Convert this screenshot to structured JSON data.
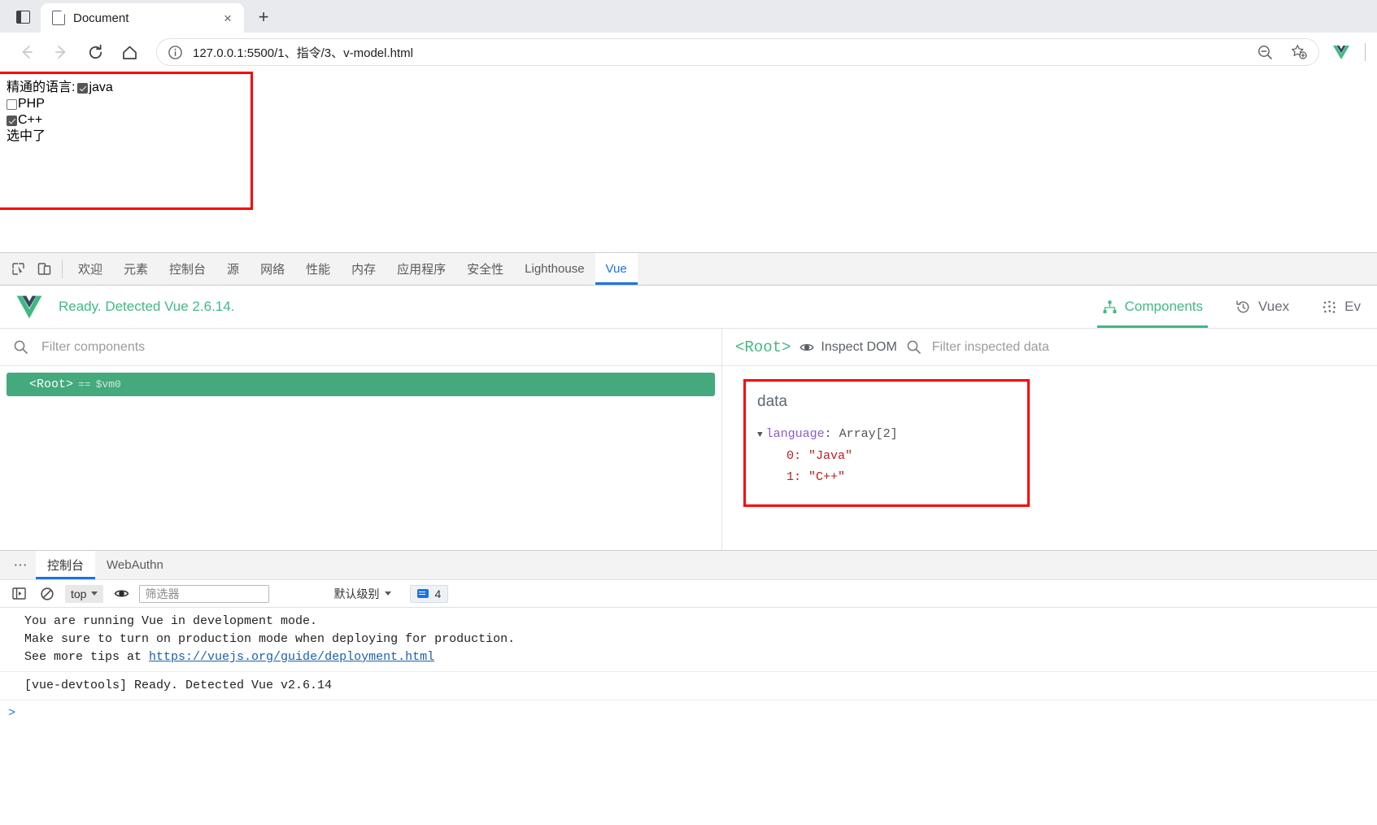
{
  "browser": {
    "window_icon": "window-panel-icon",
    "tab": {
      "title": "Document",
      "favicon": "document-icon",
      "close_label": "×"
    },
    "new_tab_label": "+",
    "nav": {
      "back": "←",
      "forward": "→",
      "reload": "↻",
      "home": "⌂"
    },
    "omnibox": {
      "info_icon": "info-circle-icon",
      "url": "127.0.0.1:5500/1、指令/3、v-model.html",
      "zoom_out_icon": "zoom-out-icon",
      "bookmark_icon": "bookmark-star-add-icon"
    },
    "extension": "vue-devtools-extension-icon"
  },
  "page": {
    "label_lead": "精通的语言:",
    "options": [
      {
        "label": "java",
        "checked": true
      },
      {
        "label": "PHP",
        "checked": false
      },
      {
        "label": "C++",
        "checked": true
      }
    ],
    "status_text": "选中了"
  },
  "devtools": {
    "inspect_icon": "inspect-element-icon",
    "device_icon": "device-toolbar-icon",
    "tabs": [
      {
        "label": "欢迎",
        "active": false
      },
      {
        "label": "元素",
        "active": false
      },
      {
        "label": "控制台",
        "active": false
      },
      {
        "label": "源",
        "active": false
      },
      {
        "label": "网络",
        "active": false
      },
      {
        "label": "性能",
        "active": false
      },
      {
        "label": "内存",
        "active": false
      },
      {
        "label": "应用程序",
        "active": false
      },
      {
        "label": "安全性",
        "active": false
      },
      {
        "label": "Lighthouse",
        "active": false
      },
      {
        "label": "Vue",
        "active": true
      }
    ]
  },
  "vue": {
    "logo": "vue-logo-icon",
    "ready_text": "Ready. Detected Vue 2.6.14.",
    "header_tabs": [
      {
        "label": "Components",
        "icon": "components-tree-icon",
        "active": true
      },
      {
        "label": "Vuex",
        "icon": "vuex-history-icon",
        "active": false
      },
      {
        "label": "Ev",
        "icon": "events-dots-icon",
        "active": false
      }
    ],
    "filter_placeholder": "Filter components",
    "filter_value": "",
    "filter_icon": "search-icon",
    "tree": [
      {
        "name": "<Root>",
        "eq": "==",
        "vm": "$vm0",
        "selected": true
      }
    ],
    "inspector": {
      "root_label": "<Root>",
      "inspect_dom_label": "Inspect DOM",
      "inspect_dom_icon": "eye-target-icon",
      "search_icon": "search-icon",
      "filter_placeholder": "Filter inspected data",
      "filter_value": "",
      "data_title": "data",
      "caret": "▼",
      "key_name": "language",
      "key_sep": ":",
      "key_type": "Array[2]",
      "items": [
        {
          "index": "0:",
          "value": "\"Java\""
        },
        {
          "index": "1:",
          "value": "\"C++\""
        }
      ]
    }
  },
  "drawer": {
    "more_label": "⋯",
    "tabs": [
      {
        "label": "控制台",
        "active": true
      },
      {
        "label": "WebAuthn",
        "active": false
      }
    ],
    "toolbar": {
      "sidebar_icon": "console-sidebar-icon",
      "clear_icon": "clear-console-icon",
      "context_value": "top",
      "eye_icon": "live-expression-eye-icon",
      "filter_placeholder": "筛选器",
      "filter_value": "",
      "level_label": "默认级别",
      "message_count": "4",
      "message_icon": "message-count-icon"
    },
    "messages": [
      {
        "lines": [
          "You are running Vue in development mode.",
          "Make sure to turn on production mode when deploying for production.",
          "See more tips at "
        ],
        "link": "https://vuejs.org/guide/deployment.html"
      },
      {
        "lines": [
          "[vue-devtools] Ready. Detected Vue v2.6.14"
        ],
        "link": ""
      }
    ],
    "prompt_caret": ">"
  },
  "colors": {
    "vue_green": "#42b983",
    "chrome_blue": "#1a73e8",
    "highlight_red": "#ff0000",
    "tree_selected": "#44a97c"
  }
}
